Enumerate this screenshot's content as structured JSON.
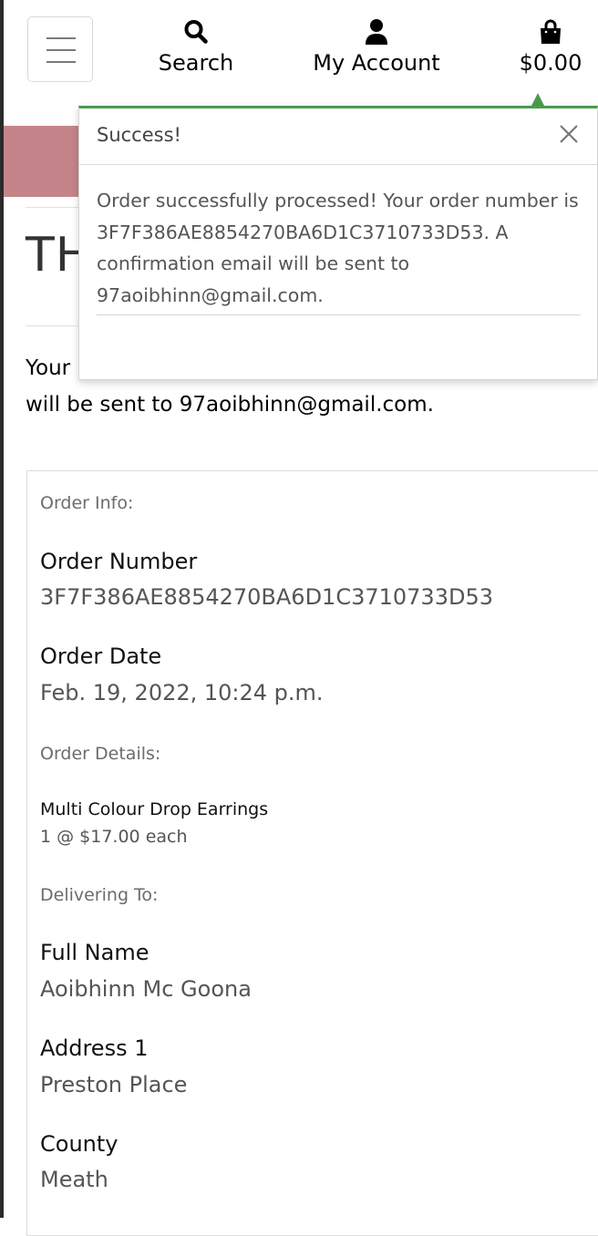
{
  "header": {
    "search_label": "Search",
    "account_label": "My Account",
    "bag_total": "$0.00",
    "icons": {
      "menu": "hamburger-icon",
      "search": "search-icon",
      "account": "user-icon",
      "bag": "shopping-bag-icon"
    }
  },
  "page": {
    "heading": "TH",
    "intro_line1": "Your",
    "intro_line2": "will be sent to 97aoibhinn@gmail.com."
  },
  "toast": {
    "title": "Success!",
    "message": "Order successfully processed! Your order number is 3F7F386AE8854270BA6D1C3710733D53. A confirmation email will be sent to 97aoibhinn@gmail.com.",
    "accent_color": "#4a9a4a"
  },
  "order": {
    "info_title": "Order Info:",
    "number_label": "Order Number",
    "number_value": "3F7F386AE8854270BA6D1C3710733D53",
    "date_label": "Order Date",
    "date_value": "Feb. 19, 2022, 10:24 p.m.",
    "details_title": "Order Details:",
    "items": [
      {
        "name": "Multi Colour Drop Earrings",
        "qty_price": "1 @ $17.00 each"
      }
    ],
    "delivery_title": "Delivering To:",
    "full_name_label": "Full Name",
    "full_name_value": "Aoibhinn Mc Goona",
    "address1_label": "Address 1",
    "address1_value": "Preston Place",
    "county_label": "County",
    "county_value": "Meath"
  },
  "colors": {
    "banner": "#c4858a",
    "success": "#4a9a4a"
  }
}
